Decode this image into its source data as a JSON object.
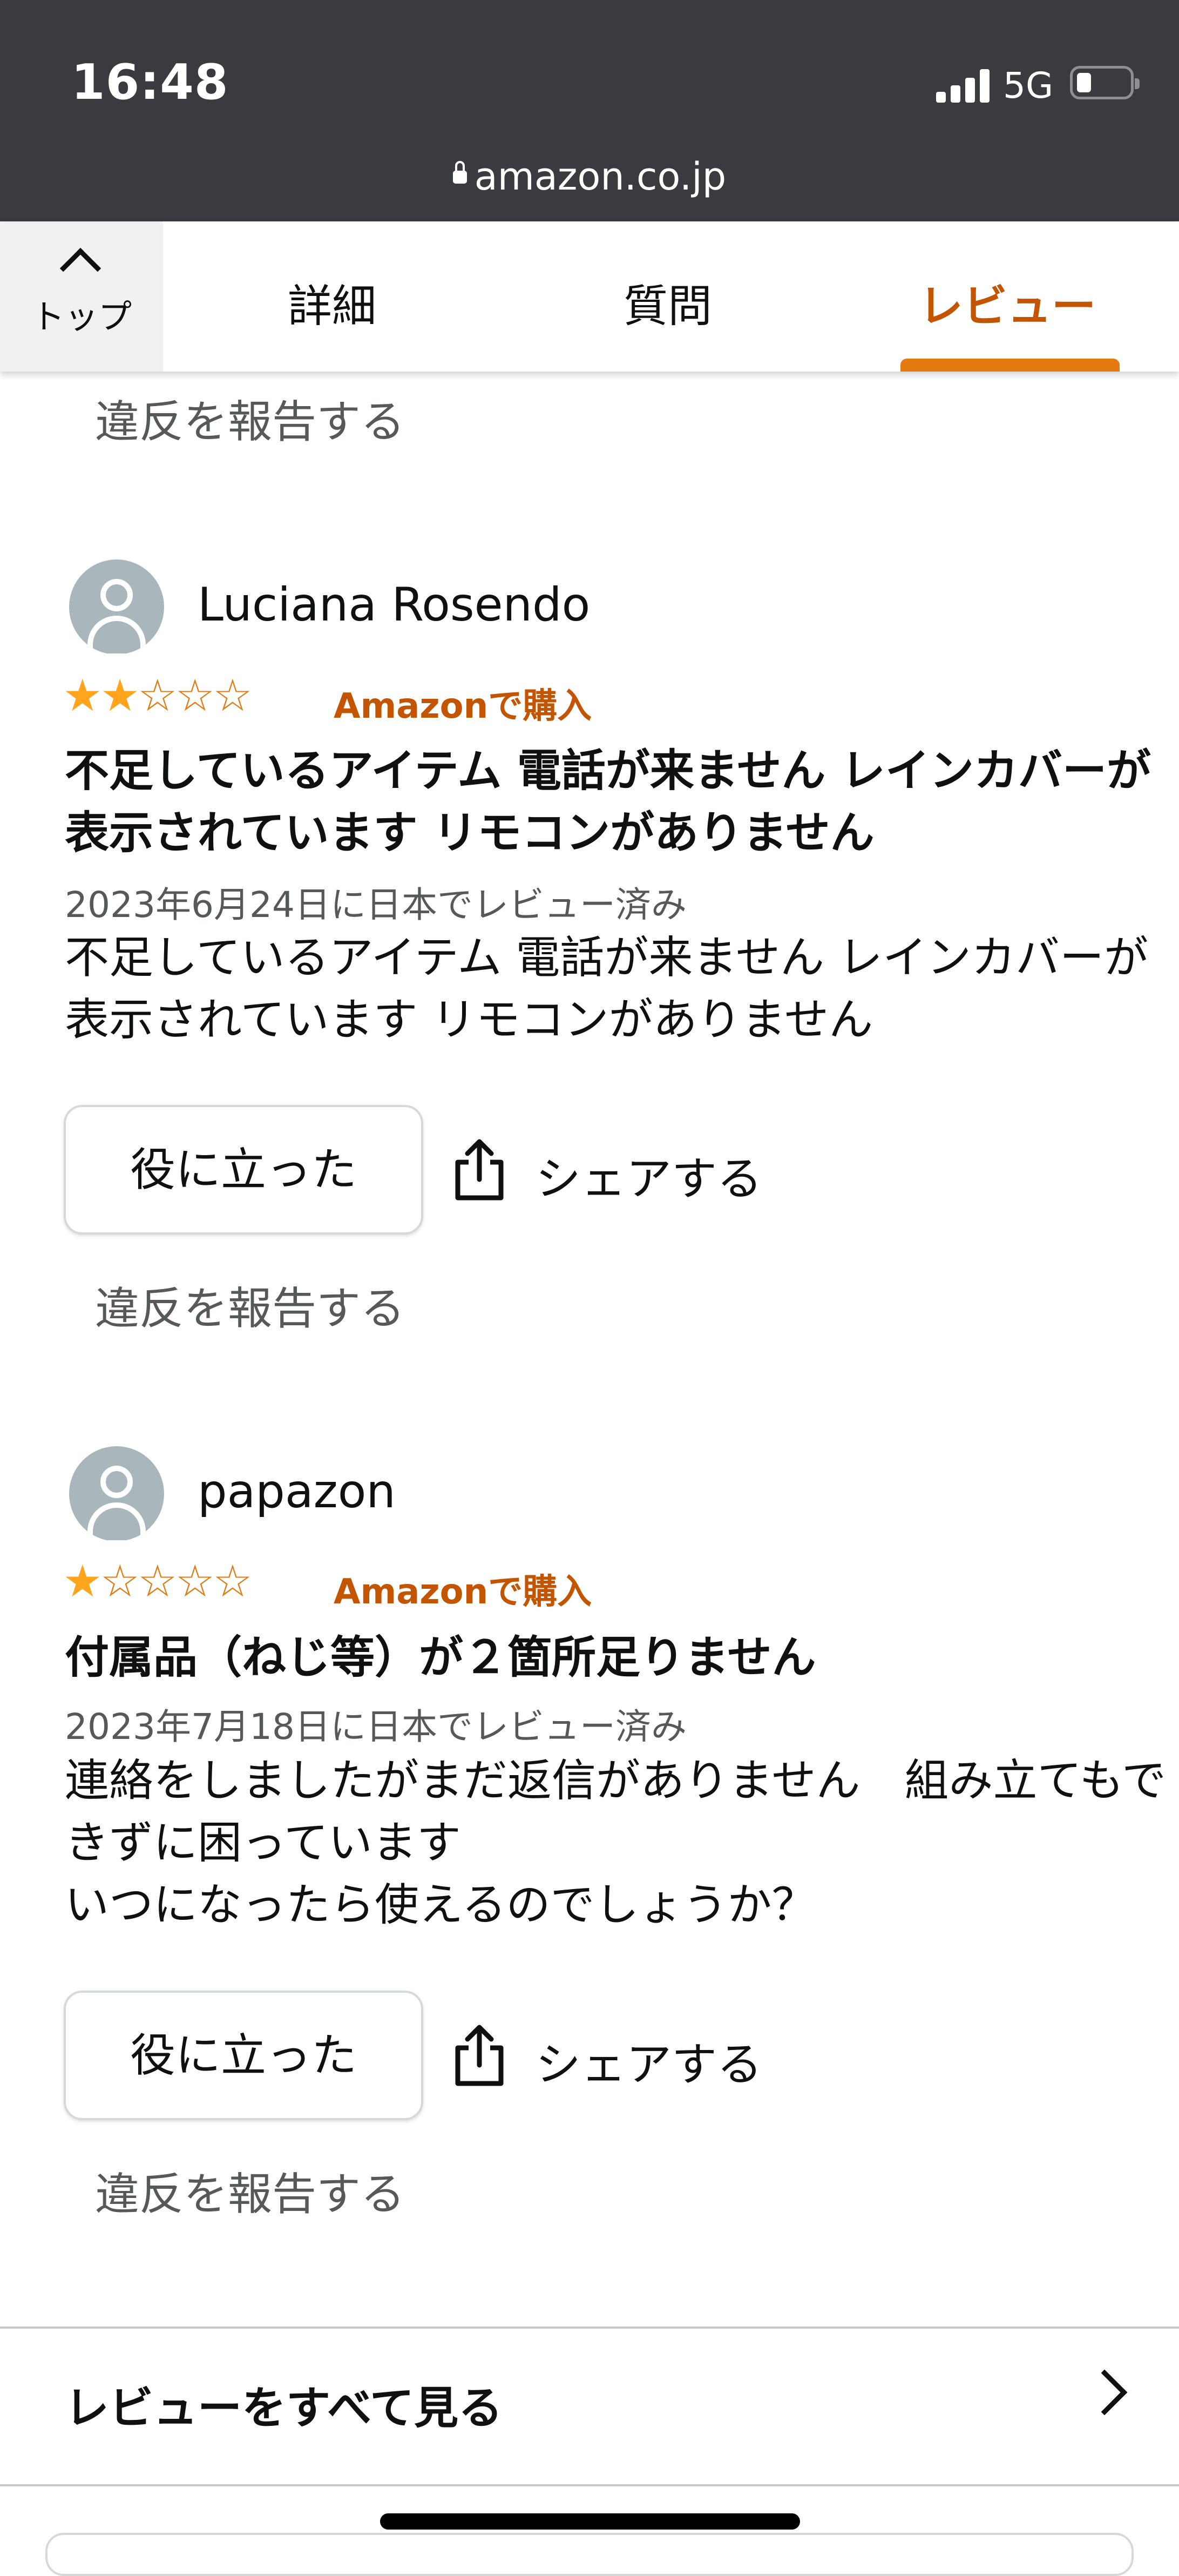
{
  "status_bar": {
    "time": "16:48",
    "network": "5G",
    "battery_icon": "battery-low-icon"
  },
  "browser": {
    "url": "amazon.co.jp"
  },
  "tabs": {
    "top_label": "トップ",
    "items": [
      {
        "label": "詳細",
        "active": false
      },
      {
        "label": "質問",
        "active": false
      },
      {
        "label": "レビュー",
        "active": true
      }
    ]
  },
  "colors": {
    "accent": "#c45500",
    "tab_underline": "#e47911",
    "star": "#ffa41c",
    "statusbar_bg": "#393b3e"
  },
  "report_label": "違反を報告する",
  "reviews": [
    {
      "name": "Luciana Rosendo",
      "rating": 2,
      "max_rating": 5,
      "badge": "Amazonで購入",
      "title": "不足しているアイテム 電話が来ません レインカバーが表示されています リモコンがありません",
      "date": "2023年6月24日に日本でレビュー済み",
      "body": "不足しているアイテム 電話が来ません レインカバーが表示されています リモコンがありません",
      "helpful_label": "役に立った",
      "share_label": "シェアする"
    },
    {
      "name": "papazon",
      "rating": 1,
      "max_rating": 5,
      "badge": "Amazonで購入",
      "title": "付属品（ねじ等）が２箇所足りません",
      "date": "2023年7月18日に日本でレビュー済み",
      "body": "連絡をしましたがまだ返信がありません　組み立てもできずに困っています\nいつになったら使えるのでしょうか？",
      "helpful_label": "役に立った",
      "share_label": "シェアする"
    }
  ],
  "see_all_label": "レビューをすべて見る"
}
